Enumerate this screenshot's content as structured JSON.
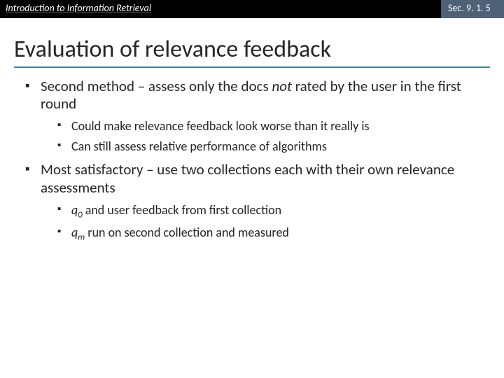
{
  "header": {
    "left": "Introduction to Information Retrieval",
    "right": "Sec. 9. 1. 5"
  },
  "title": "Evaluation of relevance feedback",
  "bullets": {
    "b1": {
      "pre": "Second method – assess only the docs ",
      "not": "not",
      "post": " rated by the user in the first round"
    },
    "b1_1": "Could make relevance feedback look worse than it really is",
    "b1_2": "Can still assess relative performance of algorithms",
    "b2": "Most satisfactory – use two collections each with their own relevance assessments",
    "b2_1": {
      "q": "q",
      "sub": "0",
      "rest": " and user feedback from first collection"
    },
    "b2_2": {
      "q": "q",
      "sub": "m",
      "rest": " run on second collection and measured"
    }
  }
}
